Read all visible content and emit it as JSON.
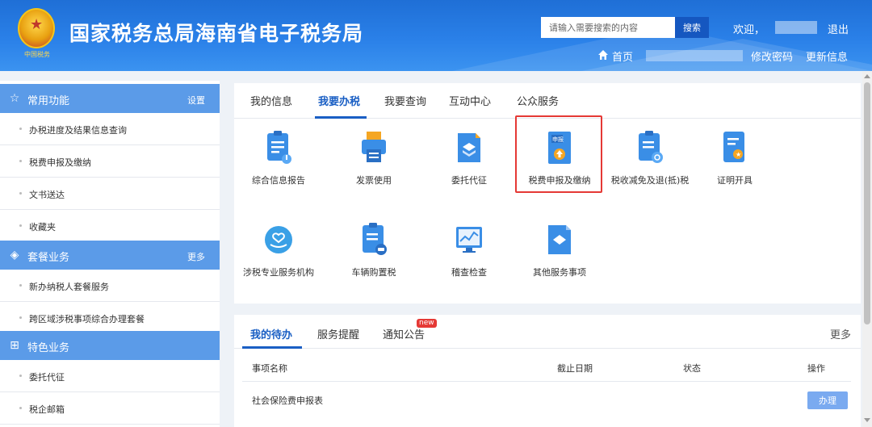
{
  "header": {
    "site_title": "国家税务总局海南省电子税务局",
    "emblem_caption": "中国税务",
    "search_placeholder": "请输入需要搜索的内容",
    "search_button": "搜索",
    "welcome": "欢迎，",
    "logout": "退出",
    "home": "首页",
    "change_password": "修改密码",
    "update_info": "更新信息"
  },
  "sidebar": {
    "sections": [
      {
        "title": "常用功能",
        "right": "设置",
        "icon": "star-icon",
        "items": [
          "办税进度及结果信息查询",
          "税费申报及缴纳",
          "文书送达",
          "收藏夹"
        ]
      },
      {
        "title": "套餐业务",
        "right": "更多",
        "icon": "package-icon",
        "items": [
          "新办纳税人套餐服务",
          "跨区域涉税事项综合办理套餐"
        ]
      },
      {
        "title": "特色业务",
        "right": "",
        "icon": "grid-icon",
        "items": [
          "委托代征",
          "税企邮箱"
        ]
      }
    ]
  },
  "main": {
    "tabs": [
      "我的信息",
      "我要办税",
      "我要查询",
      "互动中心",
      "公众服务"
    ],
    "active_tab": "我要办税",
    "services": [
      {
        "label": "综合信息报告",
        "icon": "report-icon"
      },
      {
        "label": "发票使用",
        "icon": "printer-icon"
      },
      {
        "label": "委托代征",
        "icon": "layers-icon"
      },
      {
        "label": "税费申报及缴纳",
        "icon": "declare-upload-icon"
      },
      {
        "label": "税收减免及退(抵)税",
        "icon": "tax-relief-icon"
      },
      {
        "label": "证明开具",
        "icon": "certificate-icon"
      },
      {
        "label": "涉税专业服务机构",
        "icon": "handshake-heart-icon"
      },
      {
        "label": "车辆购置税",
        "icon": "vehicle-tax-icon"
      },
      {
        "label": "稽查检查",
        "icon": "monitor-chart-icon"
      },
      {
        "label": "其他服务事项",
        "icon": "document-arrow-icon"
      }
    ],
    "highlighted_service": "税费申报及缴纳"
  },
  "todo": {
    "tabs": [
      "我的待办",
      "服务提醒",
      "通知公告"
    ],
    "new_badge": "new",
    "more": "更多",
    "columns": [
      "事项名称",
      "截止日期",
      "状态",
      "操作"
    ],
    "rows": [
      {
        "name": "社会保险费申报表",
        "deadline": "",
        "status": "",
        "action": "办理"
      }
    ]
  },
  "colors": {
    "header_blue": "#2a80e8",
    "sidebar_head": "#5b9be8",
    "active_tab": "#1a5fc4",
    "highlight_border": "#e53935",
    "icon_blue": "#3a8ee6"
  }
}
